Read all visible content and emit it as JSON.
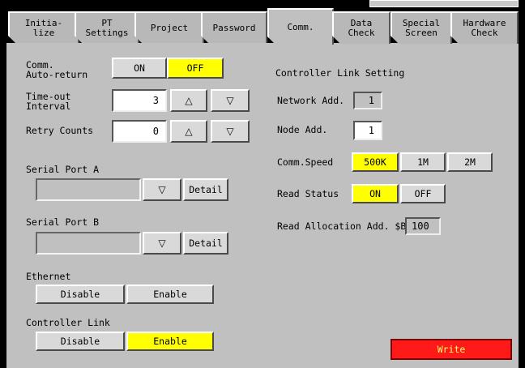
{
  "tabs": [
    {
      "label": "Initia-\nlize"
    },
    {
      "label": "PT\nSettings"
    },
    {
      "label": "Project"
    },
    {
      "label": "Password"
    },
    {
      "label": "Comm."
    },
    {
      "label": "Data\nCheck"
    },
    {
      "label": "Special\nScreen"
    },
    {
      "label": "Hardware\nCheck"
    }
  ],
  "active_tab": "Comm.",
  "comm_auto_return": {
    "label": "Comm.\nAuto-return",
    "on_label": "ON",
    "off_label": "OFF",
    "selected": "OFF"
  },
  "timeout": {
    "label": "Time-out\nInterval",
    "value": "3"
  },
  "retry": {
    "label": "Retry Counts",
    "value": "0"
  },
  "arrows": {
    "up": "△",
    "down": "▽"
  },
  "serial_a": {
    "label": "Serial Port A",
    "value": "",
    "detail_label": "Detail"
  },
  "serial_b": {
    "label": "Serial Port B",
    "value": "",
    "detail_label": "Detail"
  },
  "ethernet": {
    "label": "Ethernet",
    "disable_label": "Disable",
    "enable_label": "Enable",
    "selected": "none"
  },
  "controller_link": {
    "label": "Controller Link",
    "disable_label": "Disable",
    "enable_label": "Enable",
    "selected": "Enable"
  },
  "cl_setting": {
    "title": "Controller Link Setting",
    "network_label": "Network Add.",
    "network_value": "1",
    "node_label": "Node Add.",
    "node_value": "1",
    "speed_label": "Comm.Speed",
    "speed_options": [
      "500K",
      "1M",
      "2M"
    ],
    "speed_selected": "500K",
    "read_status_label": "Read Status",
    "read_on": "ON",
    "read_off": "OFF",
    "read_selected": "ON",
    "alloc_label": "Read Allocation Add. $B",
    "alloc_value": "100"
  },
  "write_label": "Write",
  "colors": {
    "selected": "#ffff00",
    "write": "#ff1a1a",
    "panel": "#c0c0c0"
  }
}
